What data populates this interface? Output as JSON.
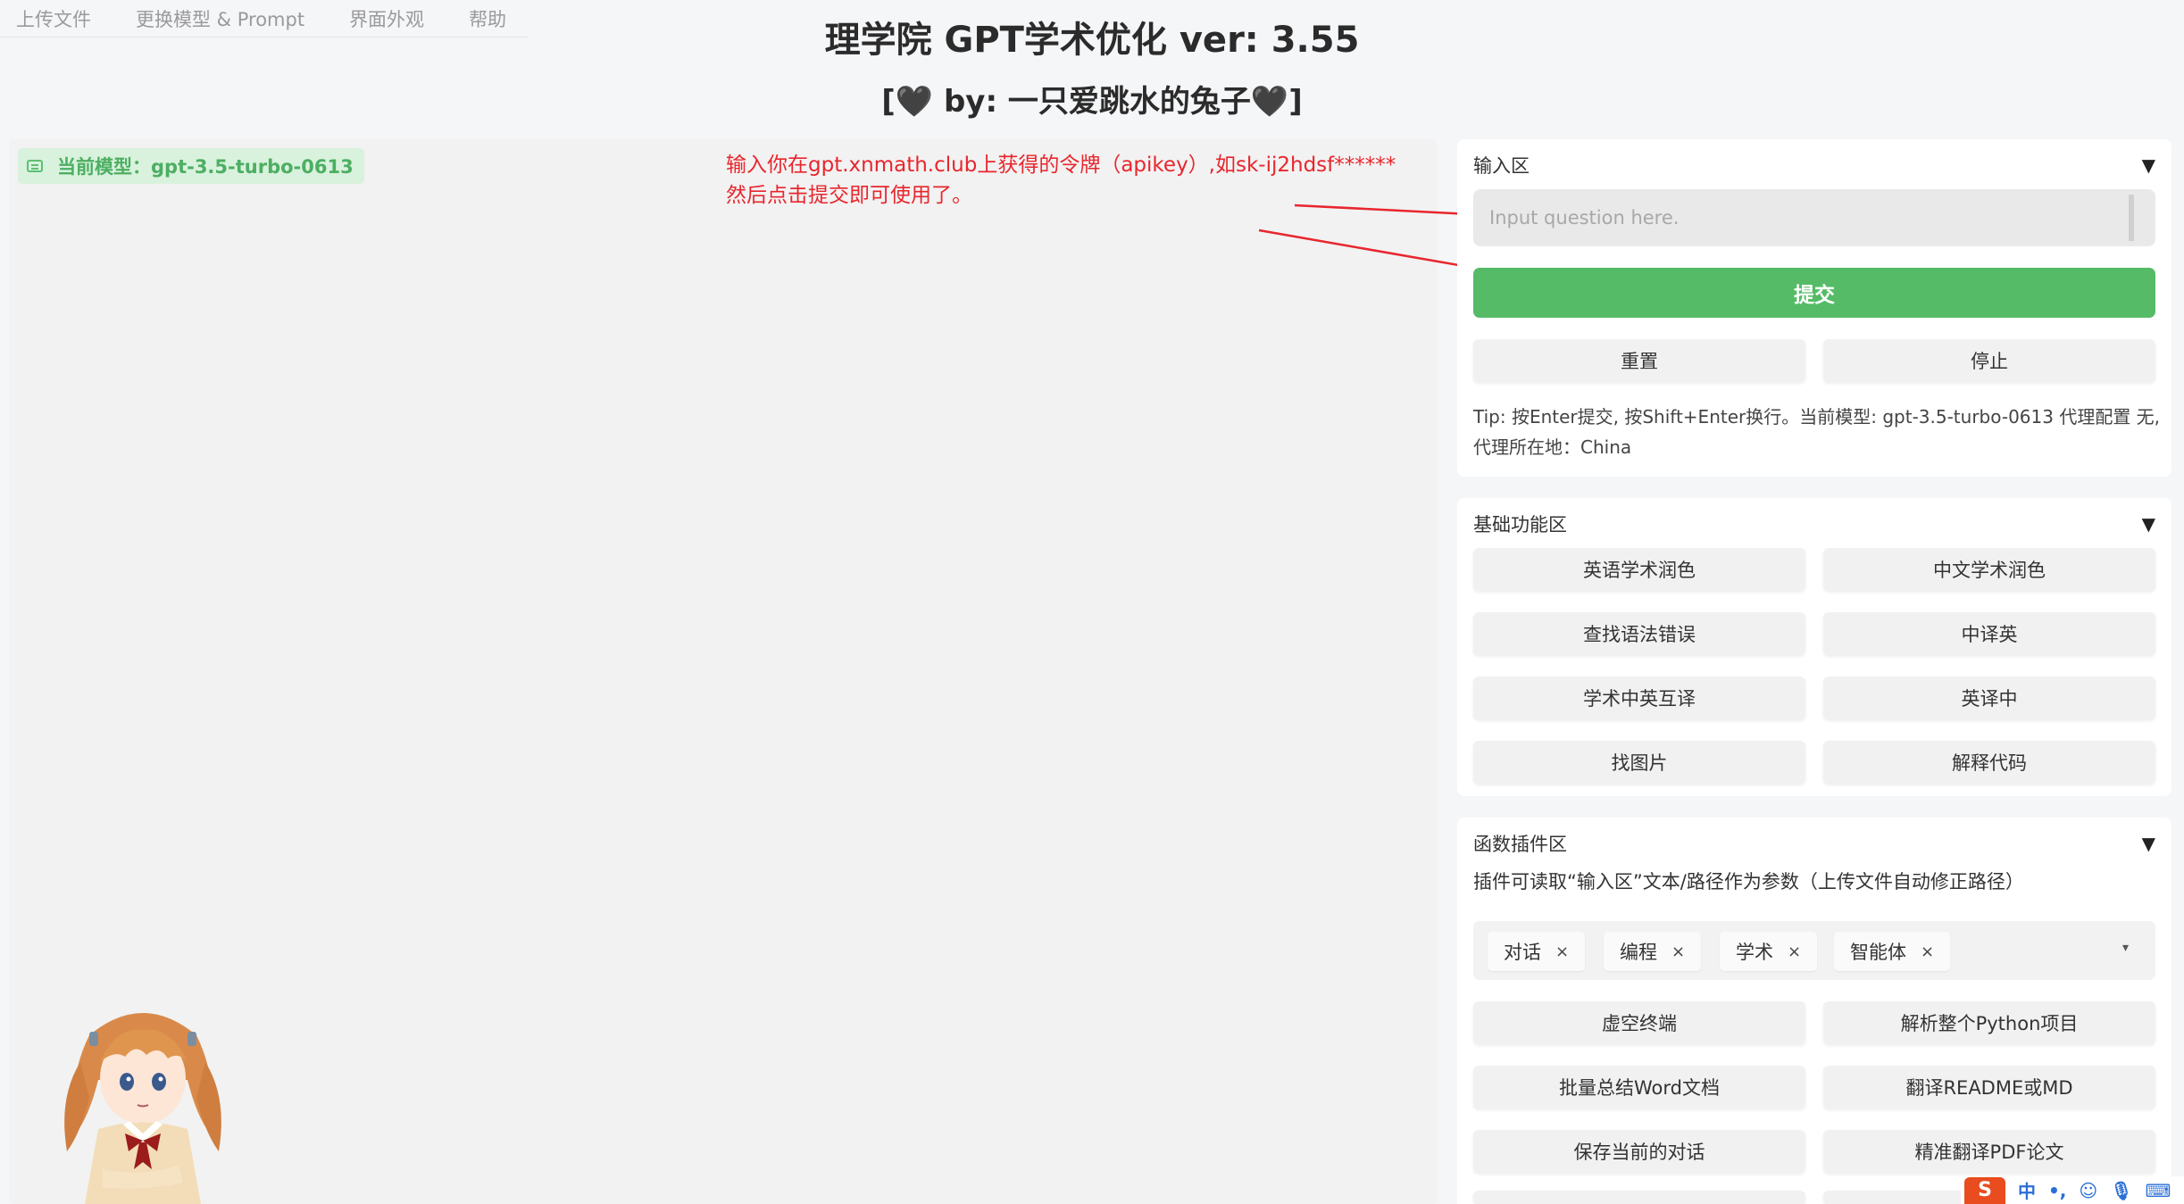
{
  "nav": {
    "items": [
      "上传文件",
      "更换模型 & Prompt",
      "界面外观",
      "帮助"
    ]
  },
  "header": {
    "title": "理学院 GPT学术优化 ver: 3.55",
    "subtitle": "[🖤 by: 一只爱跳水的兔子🖤]"
  },
  "chat": {
    "model_badge": "当前模型：gpt-3.5-turbo-0613",
    "annotation_line1": "输入你在gpt.xnmath.club上获得的令牌（apikey）,如sk-ij2hdsf******",
    "annotation_line2": "然后点击提交即可使用了。"
  },
  "input_section": {
    "header": "输入区",
    "placeholder": "Input question here.",
    "submit_label": "提交",
    "reset_label": "重置",
    "stop_label": "停止",
    "tip": "Tip: 按Enter提交, 按Shift+Enter换行。当前模型: gpt-3.5-turbo-0613 代理配置 无, 代理所在地：China"
  },
  "basic_section": {
    "header": "基础功能区",
    "buttons": [
      "英语学术润色",
      "中文学术润色",
      "查找语法错误",
      "中译英",
      "学术中英互译",
      "英译中",
      "找图片",
      "解释代码"
    ]
  },
  "plugin_section": {
    "header": "函数插件区",
    "description": "插件可读取“输入区”文本/路径作为参数（上传文件自动修正路径）",
    "tags": [
      "对话",
      "编程",
      "学术",
      "智能体"
    ],
    "tag_remove_symbol": "×",
    "buttons": [
      "虚空终端",
      "解析整个Python项目",
      "批量总结Word文档",
      "翻译README或MD",
      "保存当前的对话",
      "精准翻译PDF论文"
    ]
  },
  "ime": {
    "logo": "S",
    "mode": "中"
  },
  "colors": {
    "accent_green": "#55bb66",
    "annotation_red": "#e8262d"
  }
}
